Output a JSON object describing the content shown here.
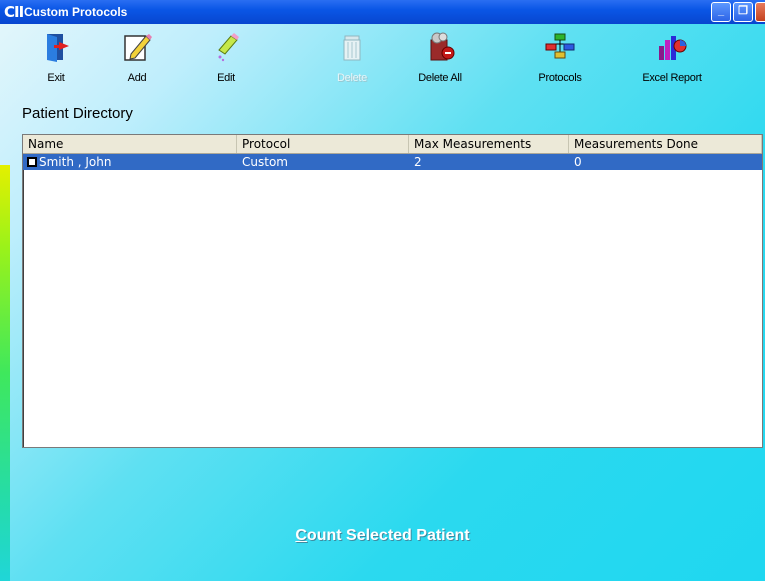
{
  "window": {
    "title": "Custom Protocols",
    "app_icon_text": "CII",
    "buttons": {
      "minimize": "_",
      "restore": "❐"
    }
  },
  "toolbar": {
    "items": [
      {
        "label": "Exit",
        "icon": "exit-door-icon",
        "enabled": true
      },
      {
        "label": "Add",
        "icon": "add-pencil-icon",
        "enabled": true
      },
      {
        "label": "Edit",
        "icon": "edit-eraser-icon",
        "enabled": true
      },
      {
        "label": "Delete",
        "icon": "trash-can-icon",
        "enabled": false
      },
      {
        "label": "Delete All",
        "icon": "full-trash-icon",
        "enabled": true
      },
      {
        "label": "Protocols",
        "icon": "protocol-tree-icon",
        "enabled": true
      },
      {
        "label": "Excel Report",
        "icon": "excel-chart-icon",
        "enabled": true
      }
    ]
  },
  "directory": {
    "title": "Patient Directory",
    "columns": [
      "Name",
      "Protocol",
      "Max Measurements",
      "Measurements Done"
    ],
    "rows": [
      {
        "name": "Smith , John",
        "protocol": "Custom",
        "max": "2",
        "done": "0",
        "checked": false,
        "selected": true
      }
    ]
  },
  "footer": {
    "count_first": "C",
    "count_rest": "ount Selected Patient"
  },
  "colors": {
    "selection": "#316ac5",
    "titlebar": "#0a56e6"
  }
}
